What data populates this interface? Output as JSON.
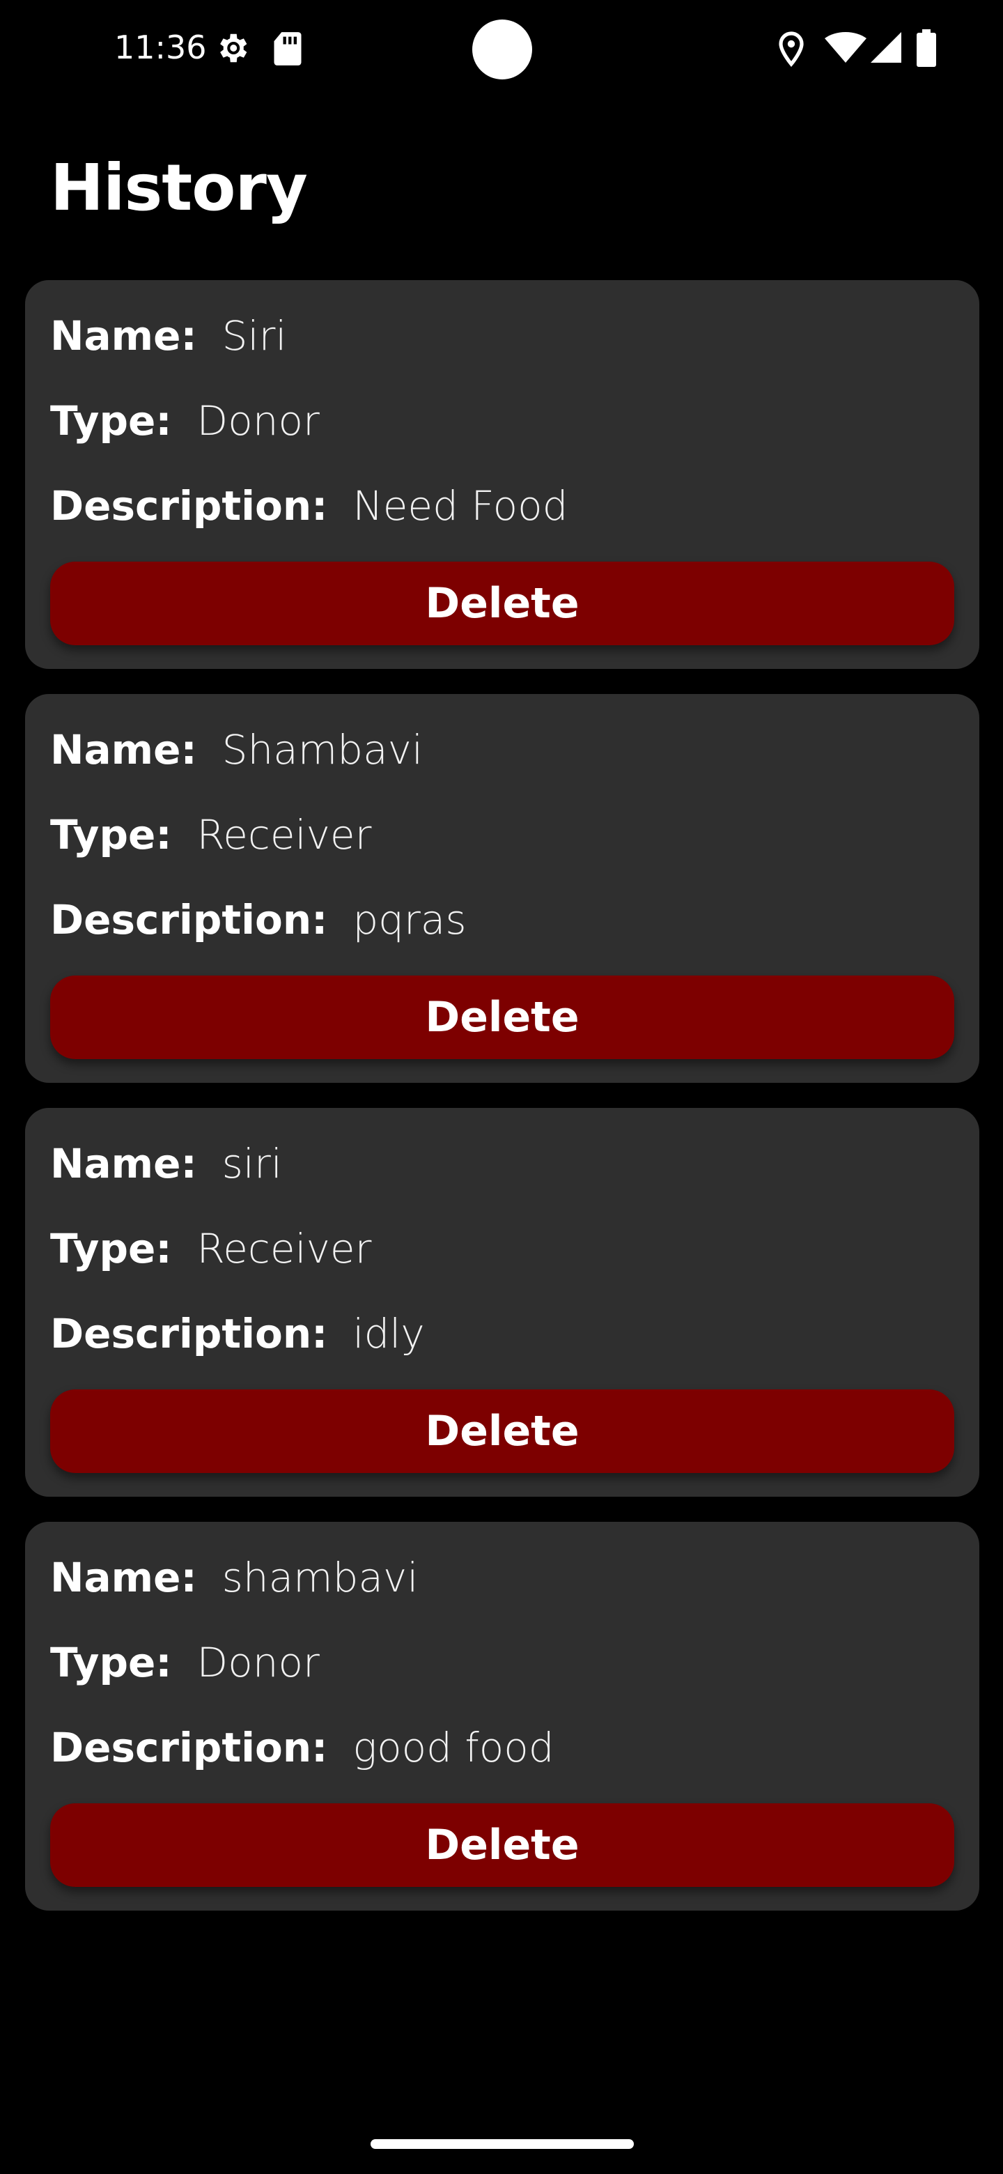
{
  "status_bar": {
    "time": "11:36",
    "icons_left": [
      "settings-gear-icon",
      "sd-card-icon"
    ],
    "icons_right": [
      "location-icon",
      "wifi-icon",
      "cellular-signal-icon",
      "battery-icon"
    ]
  },
  "page": {
    "title": "History"
  },
  "labels": {
    "name": "Name:",
    "type": "Type:",
    "description": "Description:",
    "delete": "Delete"
  },
  "history": [
    {
      "name": "Siri",
      "type": "Donor",
      "description": "Need Food"
    },
    {
      "name": "Shambavi",
      "type": "Receiver",
      "description": "pqras"
    },
    {
      "name": "siri",
      "type": "Receiver",
      "description": "idly"
    },
    {
      "name": "shambavi",
      "type": "Donor",
      "description": "good food"
    }
  ],
  "colors": {
    "background": "#000000",
    "card": "#2f2f2f",
    "delete_button": "#7d0000",
    "text": "#ffffff"
  }
}
